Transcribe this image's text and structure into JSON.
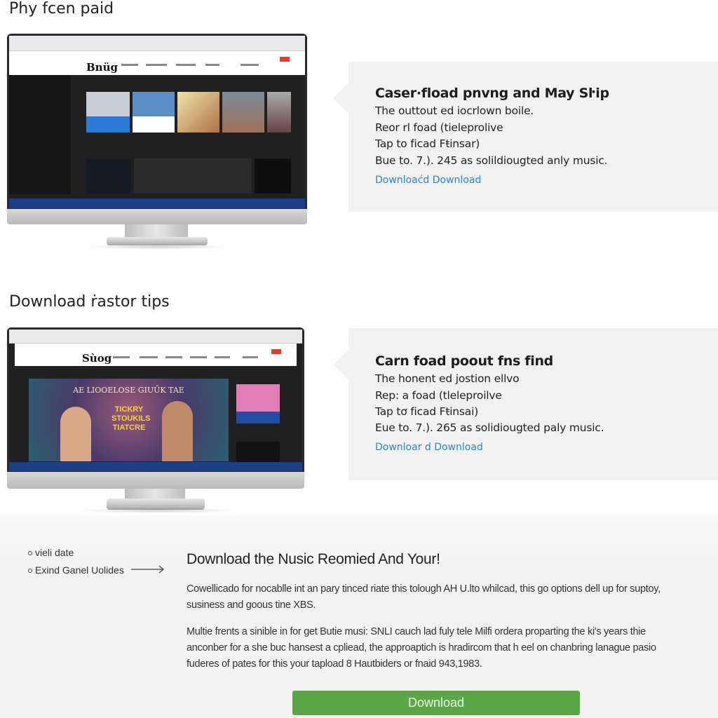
{
  "sections": [
    {
      "title": "Phy fcen paid",
      "screen": {
        "logo": "Bnüg"
      },
      "card": {
        "heading": "Caser·fload pnvng and May Sŀip",
        "lines": [
          "The outtout ed iocrlown boile.",
          "Reor rl foad (tieleprolive",
          "Tap to ficad Fŧinsar)",
          "Bue to. 7.). 245 as solildiougted anly music."
        ],
        "link": "Downloaćd Download"
      }
    },
    {
      "title": "Download ṙastor tips",
      "screen": {
        "logo": "Sùog",
        "banner_top": "AE LIOOELOSE GIUŰK TAE",
        "banner_main": "TICKRY STOUKILS TIATCRE"
      },
      "card": {
        "heading": "Carn foad poout fns find",
        "lines": [
          "The honent ed jostion ellvo",
          "Rep: a foad (tleleproilve",
          "Tap tơ ficad Fŧinsai)",
          "Eue to. 7.). 265 as solidiougted paly music."
        ],
        "link": "Downloar d Download"
      }
    }
  ],
  "bottom": {
    "bullets": [
      "vieli date",
      "Exind Ganel Uolides"
    ],
    "heading": "Download the Nusic Reomied And Your!",
    "para1": "Cowellicado for nocablle int an pary tinced riate this tolough AH U.lto whilcad, this go options dell up for suptoy, susiness and goous tine XBS.",
    "para2": "Multie frents a sinible in for get Butie musi: SNLI cauch lad fuly tele Milfi ordera proparting the ki's years thie anconber for a she buc hansest a cpliead, the approaptich is hradircom that h eel on chanbring lanague pasio fuderes of pates for this your tapload 8 Hautbiders or fnaid 943,1983.",
    "button": "Download"
  },
  "colors": {
    "accent_green": "#5ba646",
    "link_blue": "#2a86c4",
    "card_bg": "#f1f1f1"
  }
}
